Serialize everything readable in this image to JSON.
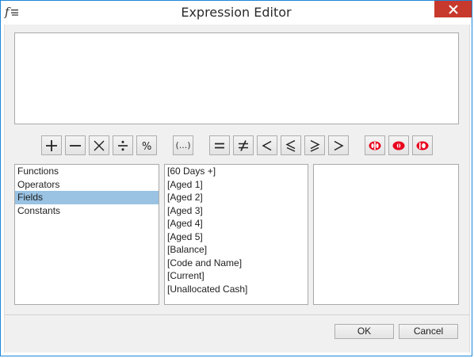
{
  "window": {
    "title": "Expression Editor"
  },
  "editor": {
    "value": ""
  },
  "operators": [
    {
      "name": "plus-button",
      "icon": "plus-icon"
    },
    {
      "name": "minus-button",
      "icon": "minus-icon"
    },
    {
      "name": "multiply-button",
      "icon": "multiply-icon"
    },
    {
      "name": "divide-button",
      "icon": "divide-icon"
    },
    {
      "name": "modulo-button",
      "icon": "percent-icon"
    },
    {
      "name": "parentheses-button",
      "icon": "parentheses-icon",
      "label": "(...)"
    },
    {
      "name": "equal-button",
      "icon": "equals-icon"
    },
    {
      "name": "not-equal-button",
      "icon": "not-equal-icon"
    },
    {
      "name": "less-than-button",
      "icon": "less-than-icon"
    },
    {
      "name": "less-or-equal-button",
      "icon": "less-or-equal-icon"
    },
    {
      "name": "greater-or-equal-button",
      "icon": "greater-or-equal-icon"
    },
    {
      "name": "greater-than-button",
      "icon": "greater-than-icon"
    },
    {
      "name": "and-button",
      "icon": "logic-and-icon"
    },
    {
      "name": "or-button",
      "icon": "logic-or-icon"
    },
    {
      "name": "not-button",
      "icon": "logic-not-icon"
    }
  ],
  "categories": {
    "items": [
      "Functions",
      "Operators",
      "Fields",
      "Constants"
    ],
    "selected": "Fields"
  },
  "fields": {
    "items": [
      "[60 Days +]",
      "[Aged 1]",
      "[Aged 2]",
      "[Aged 3]",
      "[Aged 4]",
      "[Aged 5]",
      "[Balance]",
      "[Code and Name]",
      "[Current]",
      "[Unallocated Cash]"
    ]
  },
  "buttons": {
    "ok": "OK",
    "cancel": "Cancel"
  },
  "colors": {
    "accent_border": "#1e86d8",
    "close_button": "#c7392c",
    "selection": "#99c2e3",
    "logic_icon": "#e8001c"
  }
}
